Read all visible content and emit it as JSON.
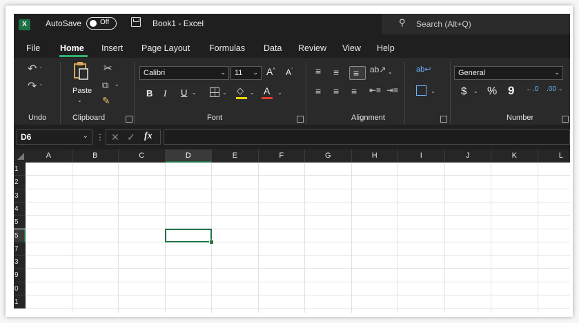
{
  "titlebar": {
    "app_icon": "X",
    "autosave_label": "AutoSave",
    "autosave_state": "Off",
    "document_title": "Book1  -  Excel",
    "search_placeholder": "Search (Alt+Q)"
  },
  "menu": {
    "tabs": [
      "File",
      "Home",
      "Insert",
      "Page Layout",
      "Formulas",
      "Data",
      "Review",
      "View",
      "Help"
    ],
    "active_tab": "Home"
  },
  "ribbon": {
    "groups": {
      "undo": "Undo",
      "clipboard": "Clipboard",
      "font": "Font",
      "alignment": "Alignment",
      "number": "Number"
    },
    "paste_label": "Paste",
    "font_name": "Calibri",
    "font_size": "11",
    "font_grow": "A",
    "font_shrink": "A",
    "bold": "B",
    "italic": "I",
    "underline": "U",
    "font_color_letter": "A",
    "number_format": "General",
    "currency_symbol": "$",
    "percent_symbol": "%",
    "comma_symbol": "9",
    "highlight_color": "#f2d600",
    "font_color": "#e03c31"
  },
  "formula_bar": {
    "name_box": "D6",
    "fx_label": "fx",
    "value": ""
  },
  "sheet": {
    "columns": [
      "A",
      "B",
      "C",
      "D",
      "E",
      "F",
      "G",
      "H",
      "I",
      "J",
      "K",
      "L"
    ],
    "rows": [
      "1",
      "2",
      "3",
      "4",
      "5",
      "5",
      "7",
      "3",
      "9",
      "0",
      "1"
    ],
    "active_column": "D",
    "active_row": "6",
    "accent": "#217346"
  }
}
